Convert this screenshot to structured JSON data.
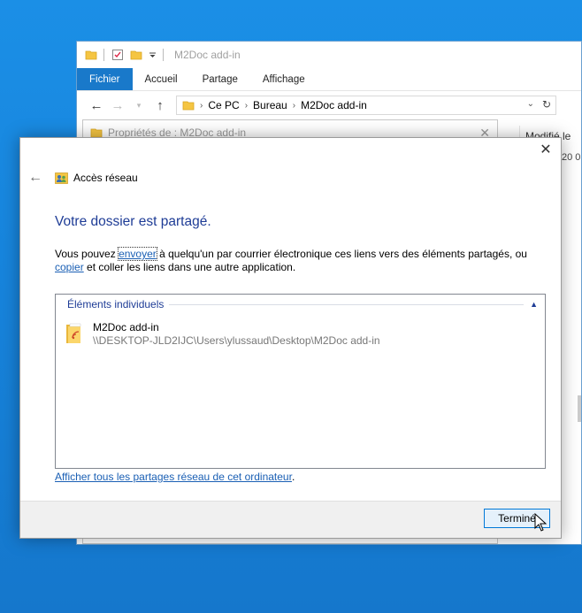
{
  "explorer": {
    "title": "M2Doc add-in",
    "ribbon_tabs": [
      "Fichier",
      "Accueil",
      "Partage",
      "Affichage"
    ],
    "breadcrumb": [
      "Ce PC",
      "Bureau",
      "M2Doc add-in"
    ],
    "column_header": "Modifié le",
    "column_value": "20 0"
  },
  "properties_window": {
    "title": "Propriétés de : M2Doc add-in"
  },
  "dialog": {
    "header_title": "Accès réseau",
    "heading": "Votre dossier est partagé.",
    "para": {
      "t1": "Vous pouvez ",
      "link_send": "envoyer",
      "t2": " à quelqu'un par courrier électronique ces liens vers des éléments partagés, ou ",
      "link_copy": "copier",
      "t3": " et coller les liens dans une autre application."
    },
    "group_label": "Éléments individuels",
    "item": {
      "name": "M2Doc add-in",
      "path": "\\\\DESKTOP-JLD2IJC\\Users\\ylussaud\\Desktop\\M2Doc add-in"
    },
    "show_all_link": "Afficher tous les partages réseau de cet ordinateur",
    "show_all_suffix": ".",
    "finish_button": "Terminé"
  },
  "colors": {
    "accent": "#1979ca",
    "heading": "#1e3c96",
    "link": "#1a5fb4",
    "desktop": "#1784dc"
  },
  "icons": [
    "folder-icon",
    "checkmark-doc-icon",
    "dropdown-arrow-icon",
    "back-arrow-icon",
    "forward-arrow-icon",
    "up-arrow-icon",
    "refresh-icon",
    "close-icon",
    "network-users-icon",
    "shared-folder-icon",
    "chevron-up-icon",
    "mouse-cursor-icon"
  ]
}
